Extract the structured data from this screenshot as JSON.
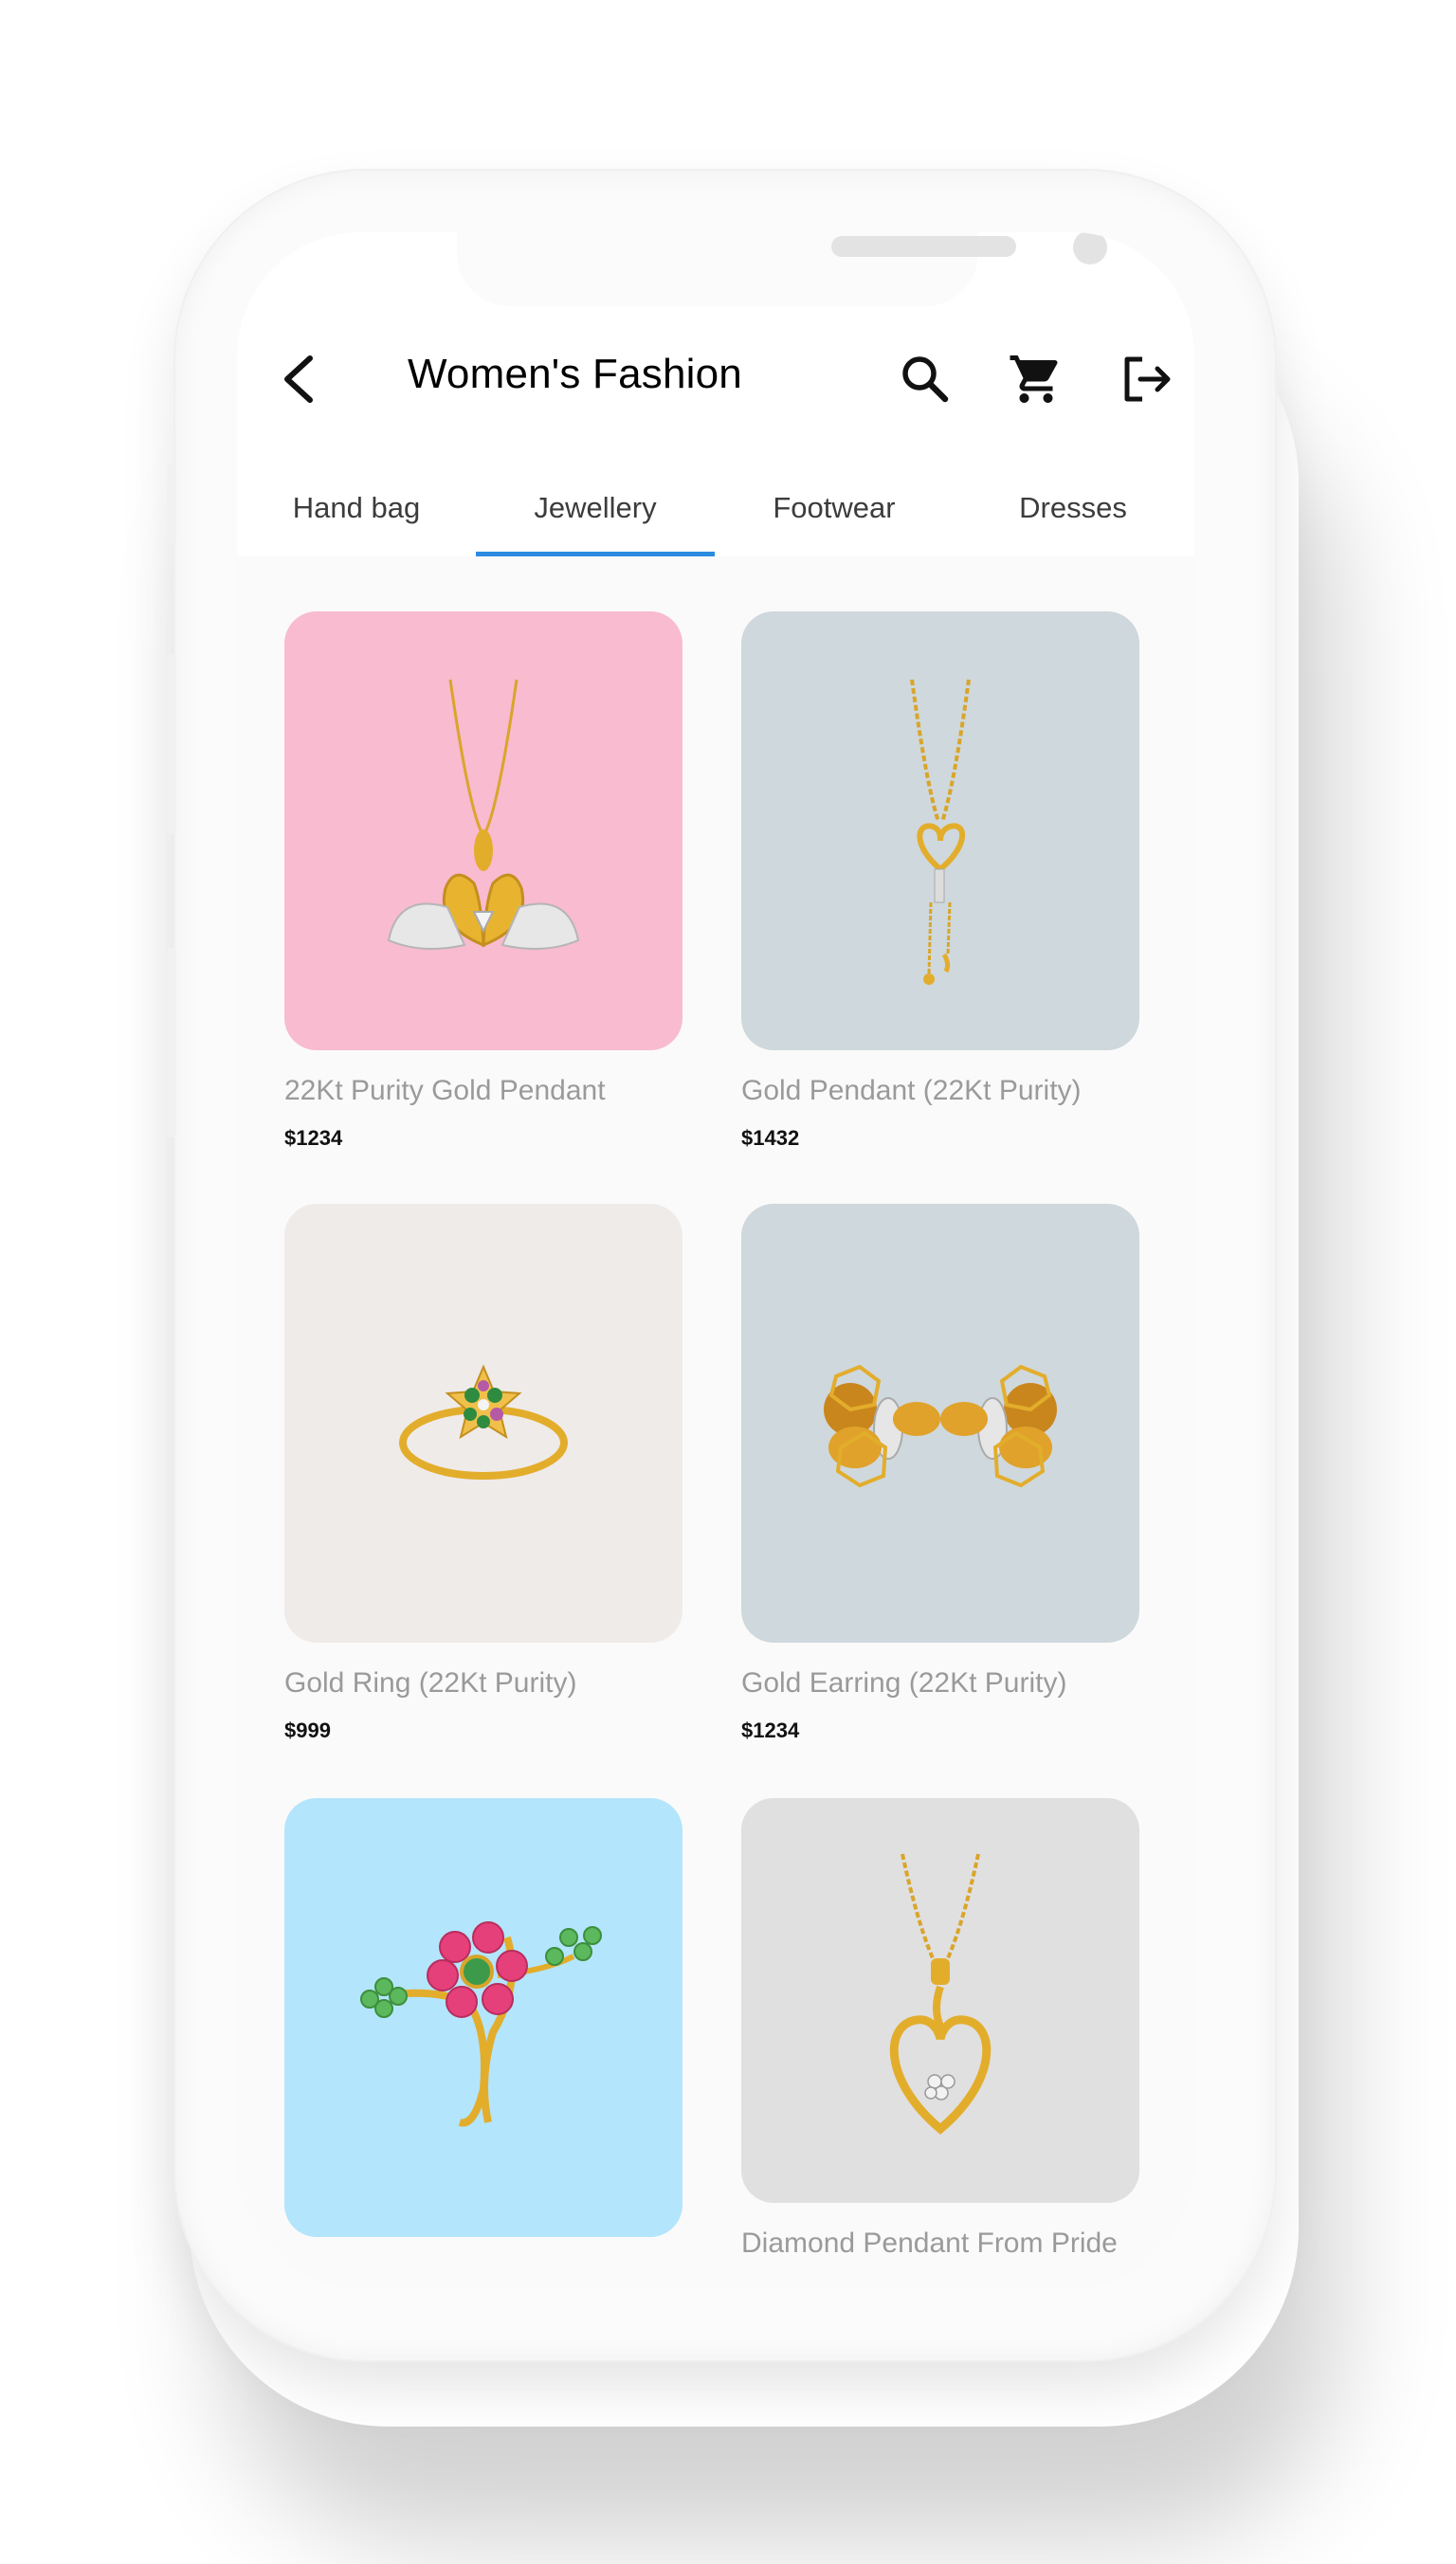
{
  "colors": {
    "tab_indicator": "#2a8ce0",
    "card_pink": "#f8bbd0",
    "card_slate": "#cfd8dc",
    "card_stone": "#efebe9",
    "card_sky": "#b3e5fc",
    "card_grey": "#e0e0e0",
    "gold": "#e3ad2c"
  },
  "appbar": {
    "title": "Women's Fashion",
    "icons": [
      "arrow-back-icon",
      "search-icon",
      "shopping-cart-icon",
      "logout-icon"
    ]
  },
  "tabs": [
    {
      "label": "Hand bag",
      "active": false
    },
    {
      "label": "Jewellery",
      "active": true
    },
    {
      "label": "Footwear",
      "active": false
    },
    {
      "label": "Dresses",
      "active": false
    }
  ],
  "products": [
    {
      "name": "22Kt Purity Gold Pendant",
      "price": "$1234",
      "image": "swan-pendant-image"
    },
    {
      "name": "Gold Pendant (22Kt Purity)",
      "price": "$1432",
      "image": "heart-key-pendant-image"
    },
    {
      "name": "Gold Ring (22Kt Purity)",
      "price": "$999",
      "image": "flower-ring-image"
    },
    {
      "name": "Gold Earring (22Kt Purity)",
      "price": "$1234",
      "image": "bee-earrings-image"
    },
    {
      "name": "",
      "price": "",
      "image": "gemstone-flower-ring-image"
    },
    {
      "name": "Diamond Pendant From Pride",
      "price": "",
      "image": "heart-pendant-image"
    }
  ]
}
